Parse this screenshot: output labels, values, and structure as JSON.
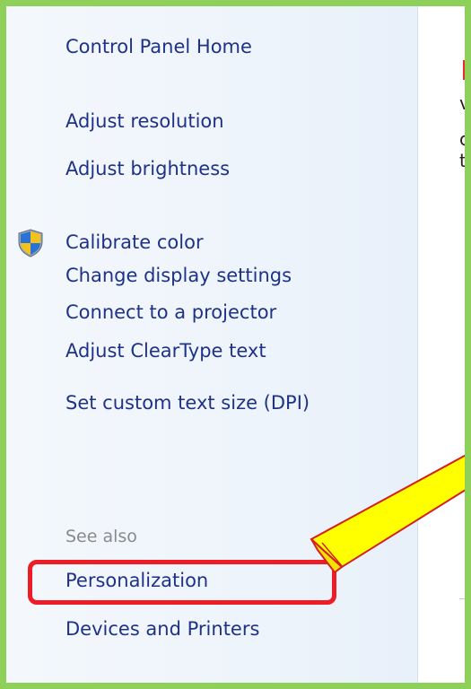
{
  "sidebar": {
    "home_link": "Control Panel Home",
    "tasks": [
      {
        "label": "Adjust resolution"
      },
      {
        "label": "Adjust brightness"
      },
      {
        "label": "Calibrate color",
        "icon": "uac-shield-icon"
      },
      {
        "label": "Change display settings"
      },
      {
        "label": "Connect to a projector"
      },
      {
        "label": "Adjust ClearType text"
      },
      {
        "label": "Set custom text size (DPI)"
      }
    ],
    "see_also": {
      "heading": "See also",
      "links": [
        {
          "label": "Personalization"
        },
        {
          "label": "Devices and Printers"
        }
      ]
    }
  },
  "annotation": {
    "highlight_color": "#ee1c24",
    "arrow_fill": "#ffff00",
    "arrow_stroke": "#d42020",
    "frame_color": "#8fd05a"
  },
  "colors": {
    "link": "#1e3287",
    "muted": "#8a8a8a"
  }
}
